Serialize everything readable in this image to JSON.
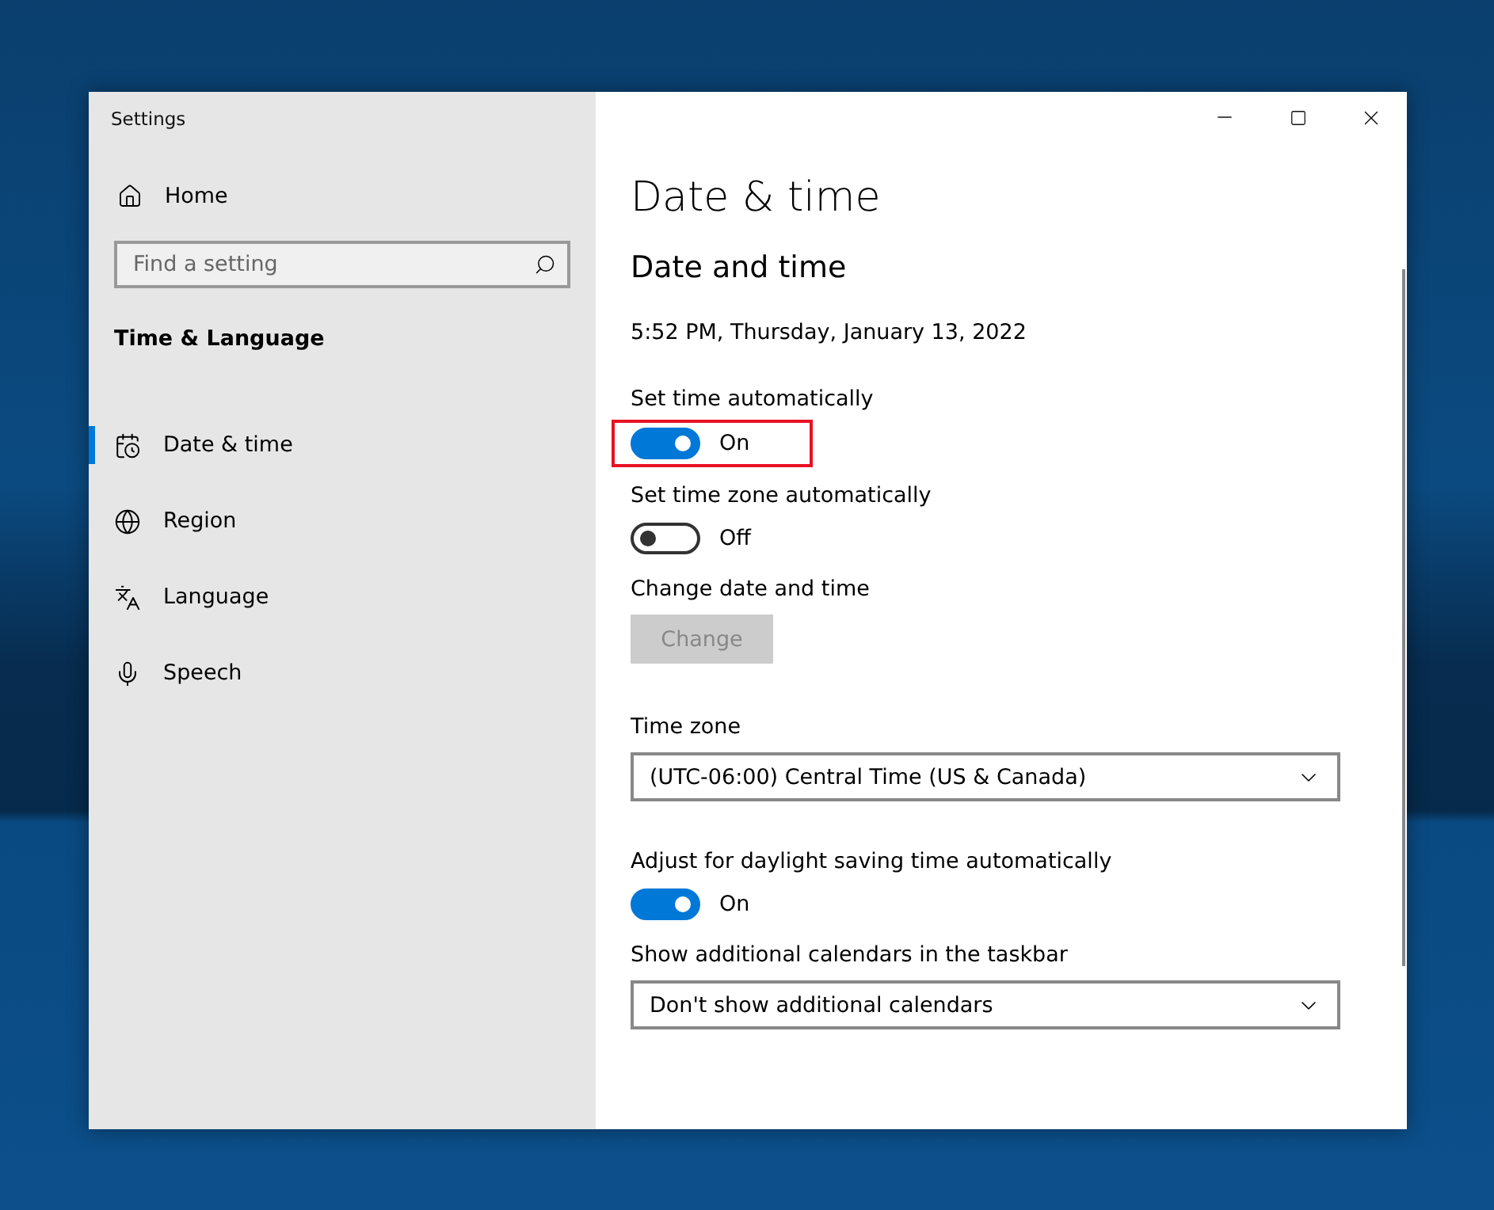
{
  "window": {
    "title": "Settings"
  },
  "sidebar": {
    "home": "Home",
    "search": {
      "placeholder": "Find a setting"
    },
    "section": "Time & Language",
    "items": [
      {
        "label": "Date & time",
        "selected": true
      },
      {
        "label": "Region",
        "selected": false
      },
      {
        "label": "Language",
        "selected": false
      },
      {
        "label": "Speech",
        "selected": false
      }
    ]
  },
  "page": {
    "title": "Date & time",
    "section": "Date and time",
    "current_time": "5:52 PM, Thursday, January 13, 2022",
    "settings": [
      {
        "kind": "toggle",
        "label": "Set time automatically",
        "on": true,
        "state_text": "On",
        "highlighted": true
      },
      {
        "kind": "toggle",
        "label": "Set time zone automatically",
        "on": false,
        "state_text": "Off",
        "highlighted": false
      },
      {
        "kind": "button",
        "label": "Change date and time",
        "button": "Change",
        "disabled": true
      },
      {
        "kind": "dropdown",
        "label": "Time zone",
        "value": "(UTC-06:00) Central Time (US & Canada)"
      },
      {
        "kind": "toggle",
        "label": "Adjust for daylight saving time automatically",
        "on": true,
        "state_text": "On",
        "highlighted": false
      },
      {
        "kind": "dropdown",
        "label": "Show additional calendars in the taskbar",
        "value": "Don't show additional calendars"
      }
    ]
  }
}
